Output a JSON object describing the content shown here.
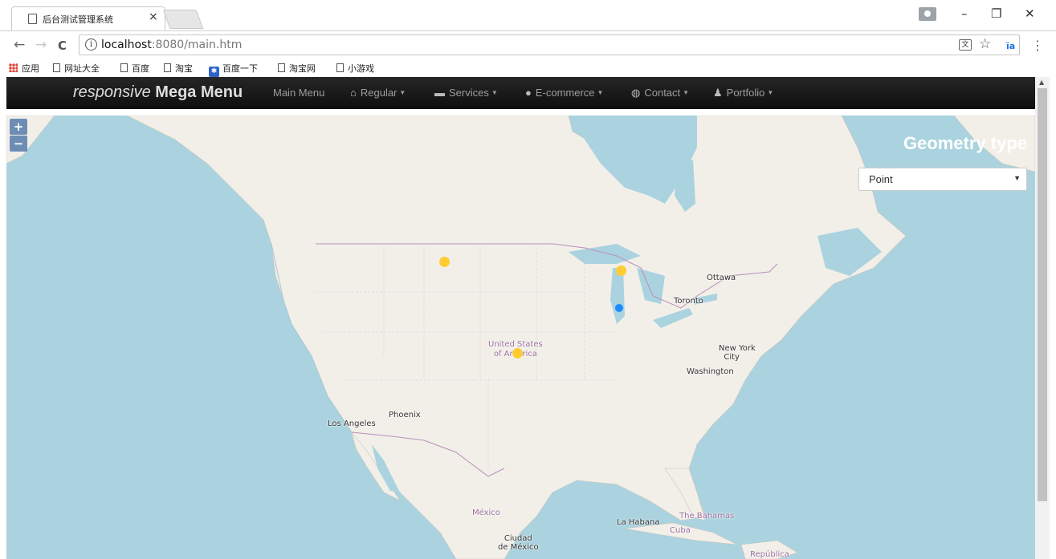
{
  "browser": {
    "tab_title": "后台测试管理系统",
    "tab_close": "×",
    "url_host": "localhost",
    "url_rest": ":8080/main.htm",
    "window_controls": {
      "minimize": "–",
      "restore": "❐",
      "close": "✕"
    },
    "nav": {
      "back": "←",
      "forward": "→",
      "reload": "C"
    }
  },
  "bookmarks": [
    {
      "label": "应用",
      "icon": "apps-icon"
    },
    {
      "label": "网址大全",
      "icon": "page-icon"
    },
    {
      "label": "百度",
      "icon": "page-icon"
    },
    {
      "label": "淘宝",
      "icon": "page-icon"
    },
    {
      "label": "百度一下",
      "icon": "baidu-paw-icon"
    },
    {
      "label": "淘宝网",
      "icon": "page-icon"
    },
    {
      "label": "小游戏",
      "icon": "page-icon"
    }
  ],
  "navbar": {
    "brand_italic": "responsive",
    "brand_bold": "Mega Menu",
    "items": [
      {
        "label": "Main Menu",
        "icon": "",
        "dropdown": false
      },
      {
        "label": "Regular",
        "icon": "home-icon",
        "dropdown": true
      },
      {
        "label": "Services",
        "icon": "briefcase-icon",
        "dropdown": true
      },
      {
        "label": "E-commerce",
        "icon": "info-circle-icon",
        "dropdown": true
      },
      {
        "label": "Contact",
        "icon": "globe-icon",
        "dropdown": true
      },
      {
        "label": "Portfolio",
        "icon": "user-icon",
        "dropdown": true
      }
    ]
  },
  "map": {
    "zoom_in": "+",
    "zoom_out": "−",
    "geometry_title": "Geometry type",
    "geometry_selected": "Point",
    "colors": {
      "water": "#aad3df",
      "land": "#f2efe9",
      "marker_yellow": "#ffcc33",
      "marker_blue": "#1a8cff"
    },
    "labels": {
      "ottawa": "Ottawa",
      "toronto": "Toronto",
      "usa_line1": "United States",
      "usa_line2": "of America",
      "new_york_1": "New York",
      "new_york_2": "City",
      "washington": "Washington",
      "phoenix": "Phoenix",
      "los_angeles": "Los Angeles",
      "mexico": "México",
      "ciudad_1": "Ciudad",
      "ciudad_2": "de México",
      "la_habana": "La Habana",
      "bahamas": "The Bahamas",
      "cuba": "Cuba",
      "republica": "República"
    }
  }
}
